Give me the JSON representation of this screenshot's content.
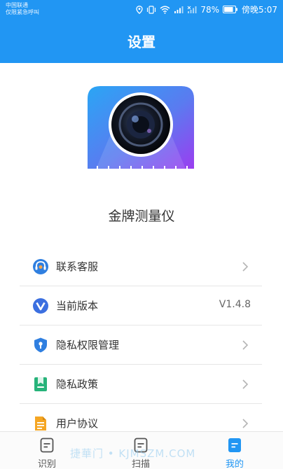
{
  "status_bar": {
    "carrier_line1": "中国联通",
    "carrier_line2": "仅限紧急呼叫",
    "battery": "78%",
    "time": "傍晚5:07"
  },
  "header": {
    "title": "设置"
  },
  "app": {
    "name": "金牌测量仪"
  },
  "menu": {
    "items": [
      {
        "label": "联系客服",
        "icon": "headset-icon"
      },
      {
        "label": "当前版本",
        "icon": "version-icon",
        "value": "V1.4.8"
      },
      {
        "label": "隐私权限管理",
        "icon": "shield-icon"
      },
      {
        "label": "隐私政策",
        "icon": "bookmark-icon"
      },
      {
        "label": "用户协议",
        "icon": "document-icon"
      }
    ]
  },
  "tabs": [
    {
      "label": "识别",
      "icon": "recognize-icon"
    },
    {
      "label": "扫描",
      "icon": "scan-icon"
    },
    {
      "label": "我的",
      "icon": "profile-icon",
      "active": true
    }
  ],
  "watermark": "捷華门 • KJMSZM.COM",
  "colors": {
    "primary": "#2196F3",
    "active_tab": "#2196F3"
  }
}
